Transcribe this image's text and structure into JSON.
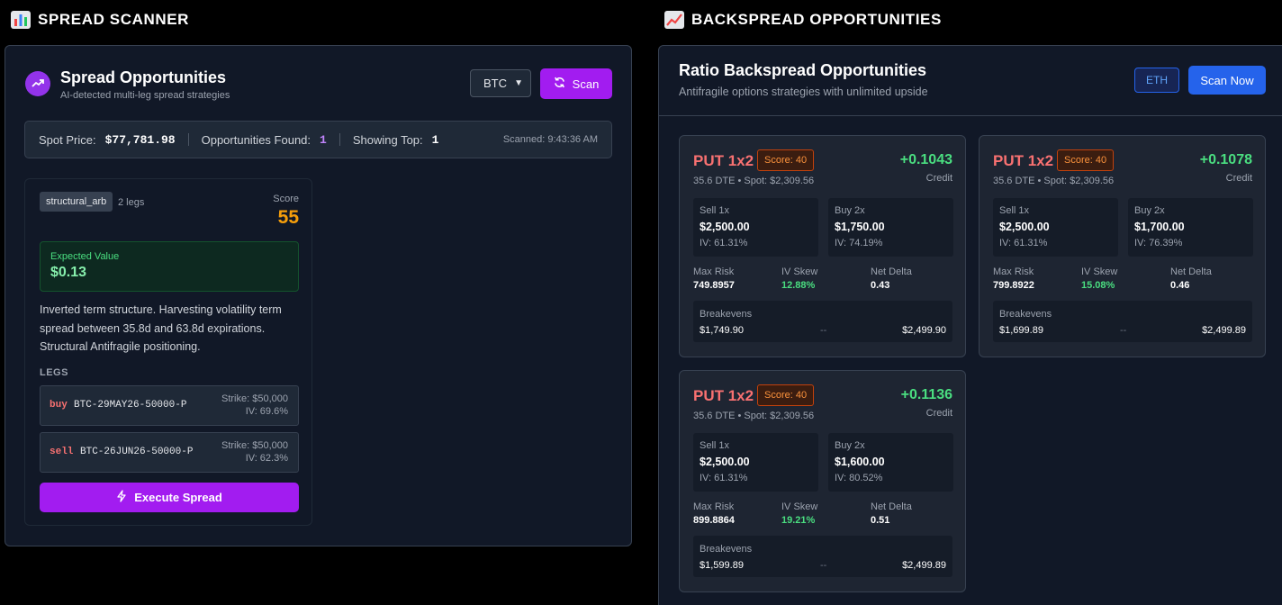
{
  "spread_scanner": {
    "section_title": "SPREAD SCANNER",
    "icon": "bar-chart-icon",
    "title": "Spread Opportunities",
    "subtitle": "AI-detected multi-leg spread strategies",
    "coin_select": "BTC",
    "scan_label": "Scan",
    "stats": {
      "spot_label": "Spot Price:",
      "spot_value": "$77,781.98",
      "found_label": "Opportunities Found:",
      "found_value": "1",
      "top_label": "Showing Top:",
      "top_value": "1",
      "scanned": "Scanned: 9:43:36 AM"
    },
    "card": {
      "tag": "structural_arb",
      "legs_count": "2 legs",
      "score_label": "Score",
      "score": "55",
      "ev_label": "Expected Value",
      "ev_value": "$0.13",
      "description": "Inverted term structure. Harvesting volatility term spread between 35.8d and 63.8d expirations. Structural Antifragile positioning.",
      "legs_heading": "LEGS",
      "legs": [
        {
          "side": "buy",
          "instrument": "BTC-29MAY26-50000-P",
          "strike": "Strike: $50,000",
          "iv": "IV: 69.6%"
        },
        {
          "side": "sell",
          "instrument": "BTC-26JUN26-50000-P",
          "strike": "Strike: $50,000",
          "iv": "IV: 62.3%"
        }
      ],
      "execute_label": "Execute Spread"
    }
  },
  "backspread": {
    "section_title": "BACKSPREAD OPPORTUNITIES",
    "icon": "trending-chart-icon",
    "title": "Ratio Backspread Opportunities",
    "subtitle": "Antifragile options strategies with unlimited upside",
    "coin_badge": "ETH",
    "scan_now_label": "Scan Now",
    "cards": [
      {
        "type": "PUT 1x2",
        "score": "Score: 40",
        "credit": "+0.1043",
        "credit_label": "Credit",
        "meta": "35.6 DTE • Spot: $2,309.56",
        "sell_label": "Sell 1x",
        "sell_price": "$2,500.00",
        "sell_iv": "IV: 61.31%",
        "buy_label": "Buy 2x",
        "buy_price": "$1,750.00",
        "buy_iv": "IV: 74.19%",
        "max_risk_label": "Max Risk",
        "max_risk": "749.8957",
        "skew_label": "IV Skew",
        "skew": "12.88%",
        "delta_label": "Net Delta",
        "delta": "0.43",
        "be_label": "Breakevens",
        "be_low": "$1,749.90",
        "be_mid": "--",
        "be_high": "$2,499.90"
      },
      {
        "type": "PUT 1x2",
        "score": "Score: 40",
        "credit": "+0.1078",
        "credit_label": "Credit",
        "meta": "35.6 DTE • Spot: $2,309.56",
        "sell_label": "Sell 1x",
        "sell_price": "$2,500.00",
        "sell_iv": "IV: 61.31%",
        "buy_label": "Buy 2x",
        "buy_price": "$1,700.00",
        "buy_iv": "IV: 76.39%",
        "max_risk_label": "Max Risk",
        "max_risk": "799.8922",
        "skew_label": "IV Skew",
        "skew": "15.08%",
        "delta_label": "Net Delta",
        "delta": "0.46",
        "be_label": "Breakevens",
        "be_low": "$1,699.89",
        "be_mid": "--",
        "be_high": "$2,499.89"
      },
      {
        "type": "PUT 1x2",
        "score": "Score: 40",
        "credit": "+0.1136",
        "credit_label": "Credit",
        "meta": "35.6 DTE • Spot: $2,309.56",
        "sell_label": "Sell 1x",
        "sell_price": "$2,500.00",
        "sell_iv": "IV: 61.31%",
        "buy_label": "Buy 2x",
        "buy_price": "$1,600.00",
        "buy_iv": "IV: 80.52%",
        "max_risk_label": "Max Risk",
        "max_risk": "899.8864",
        "skew_label": "IV Skew",
        "skew": "19.21%",
        "delta_label": "Net Delta",
        "delta": "0.51",
        "be_label": "Breakevens",
        "be_low": "$1,599.89",
        "be_mid": "--",
        "be_high": "$2,499.89"
      }
    ]
  }
}
